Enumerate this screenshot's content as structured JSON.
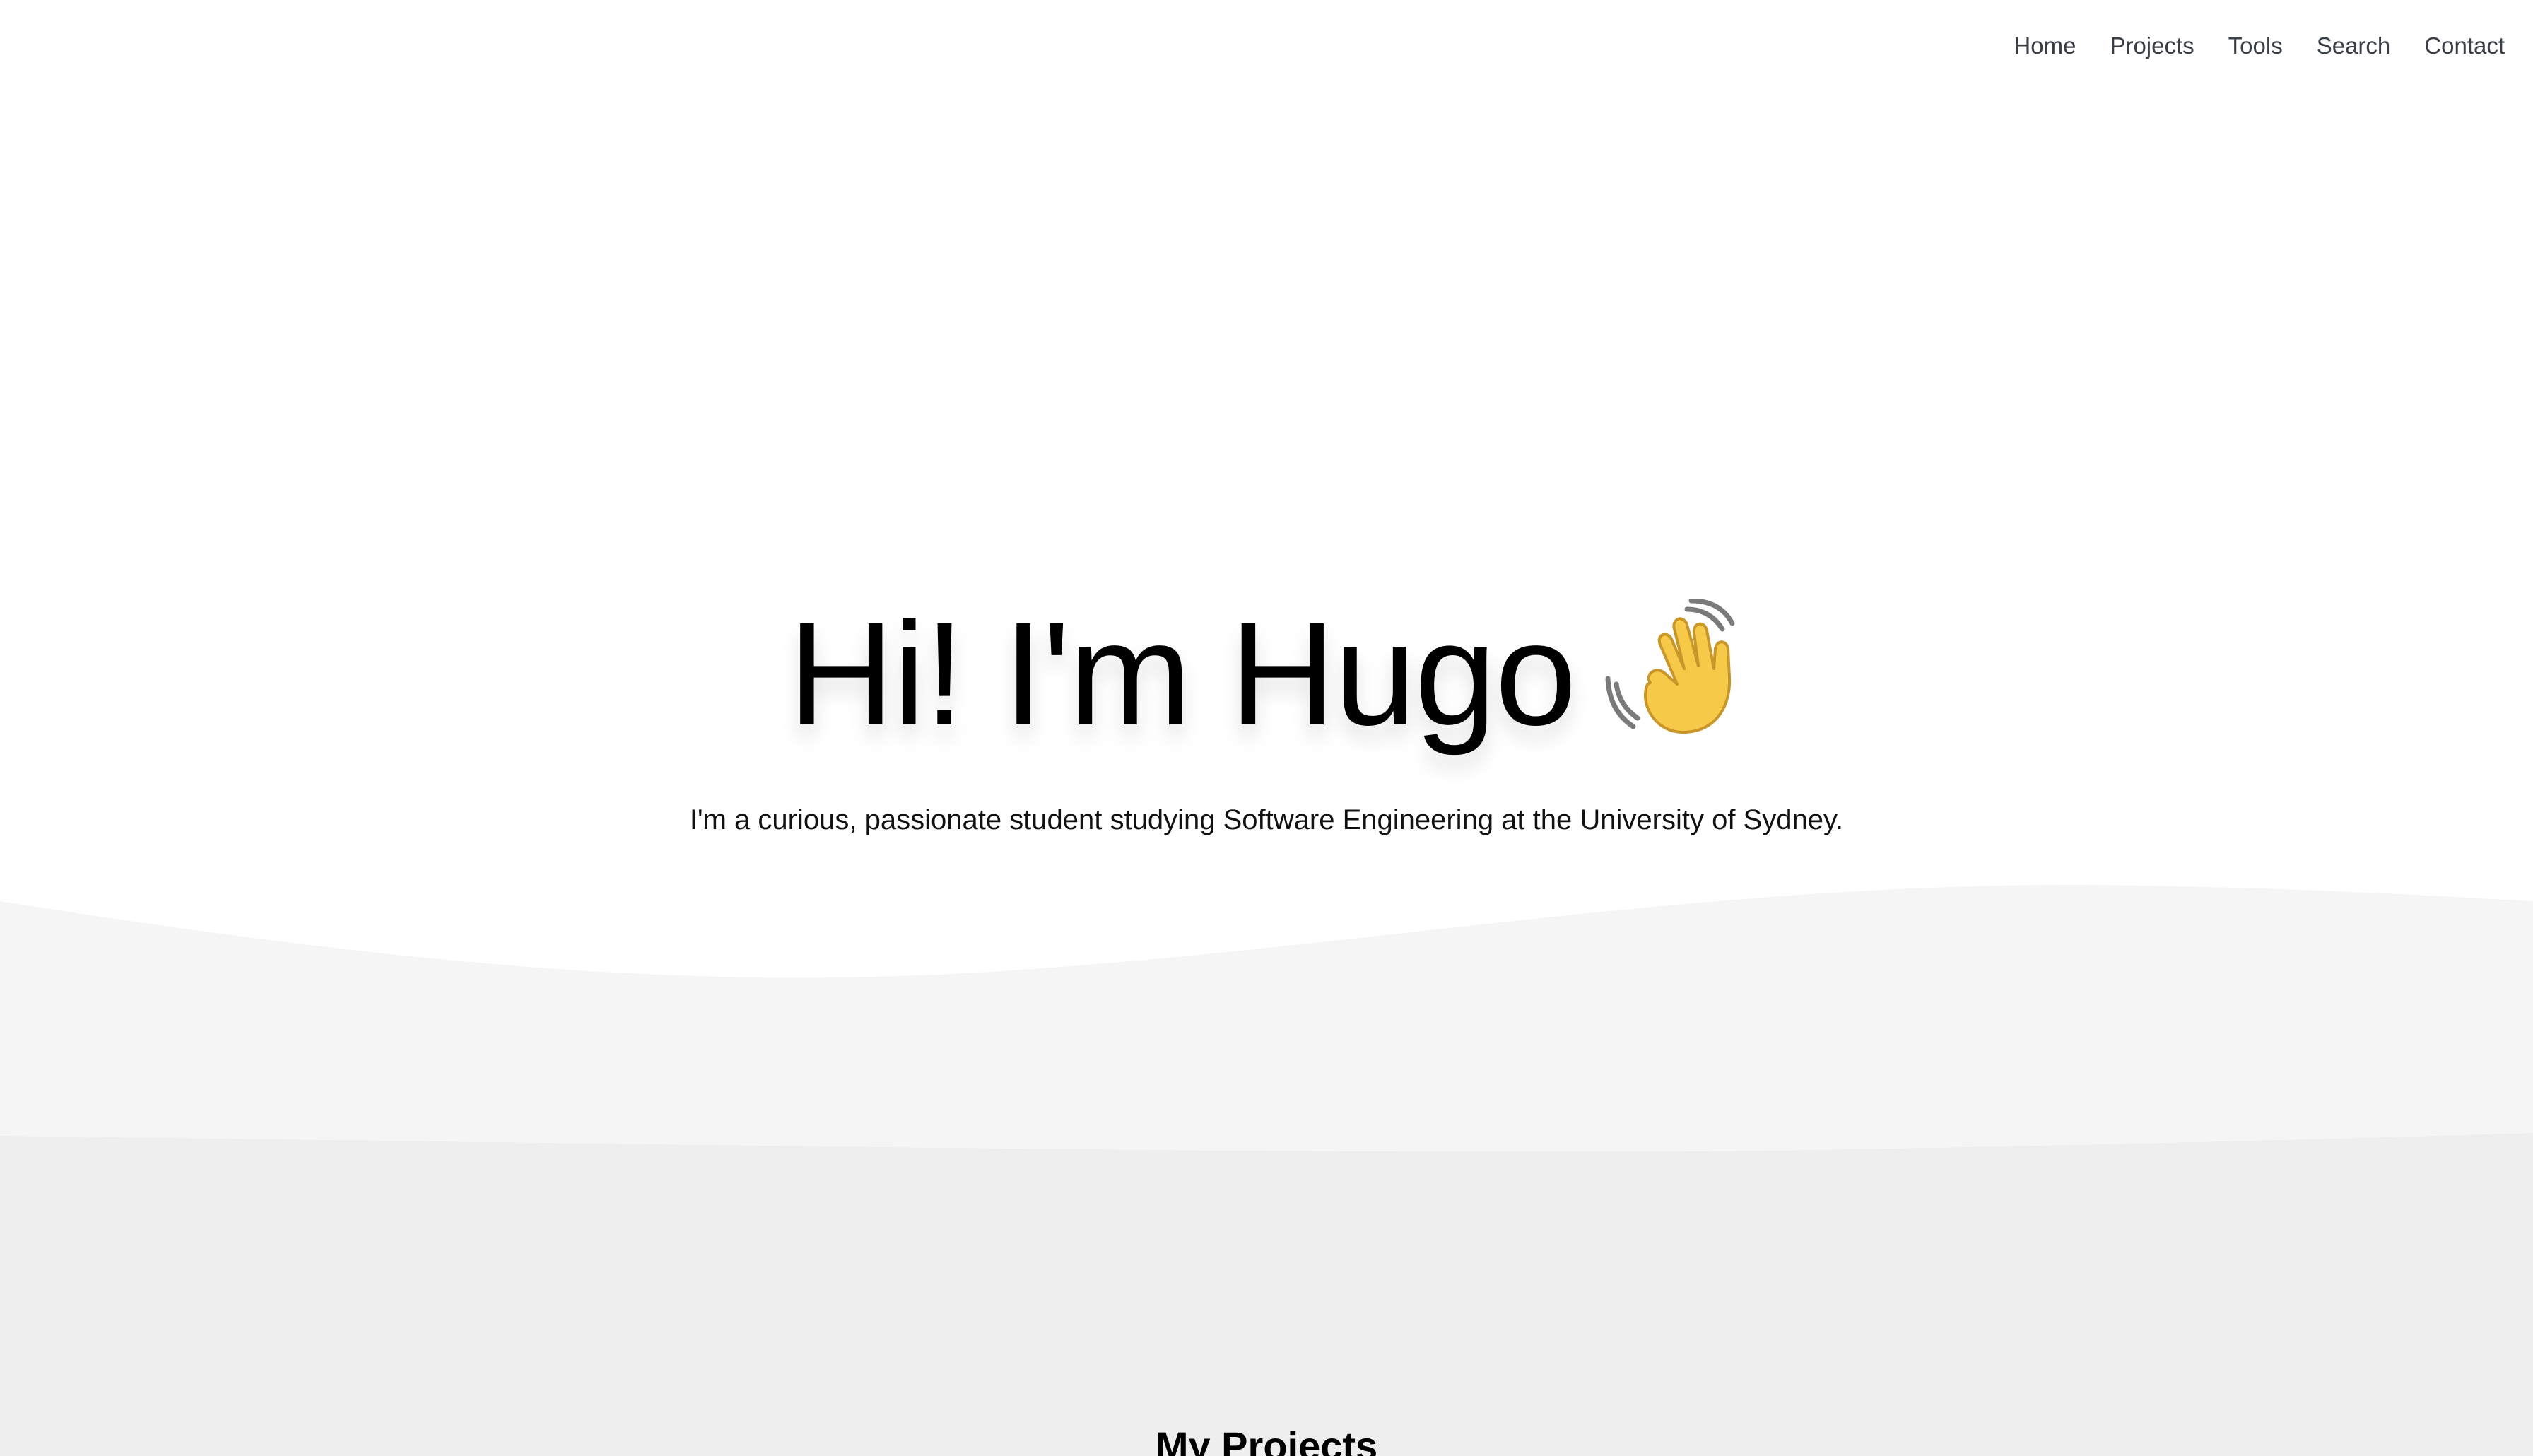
{
  "nav": {
    "items": [
      {
        "label": "Home"
      },
      {
        "label": "Projects"
      },
      {
        "label": "Tools"
      },
      {
        "label": "Search"
      },
      {
        "label": "Contact"
      }
    ]
  },
  "hero": {
    "title": "Hi! I'm Hugo",
    "emoji_icon": "waving-hand-icon",
    "subtitle": "I'm a curious, passionate student studying Software Engineering at the University of Sydney."
  },
  "projects": {
    "title": "My Projects"
  },
  "colors": {
    "background": "#ffffff",
    "wave_light": "#f5f5f5",
    "wave_dark": "#eeeeee",
    "nav_text": "#3a3f47",
    "hand_yellow": "#f7c948"
  }
}
